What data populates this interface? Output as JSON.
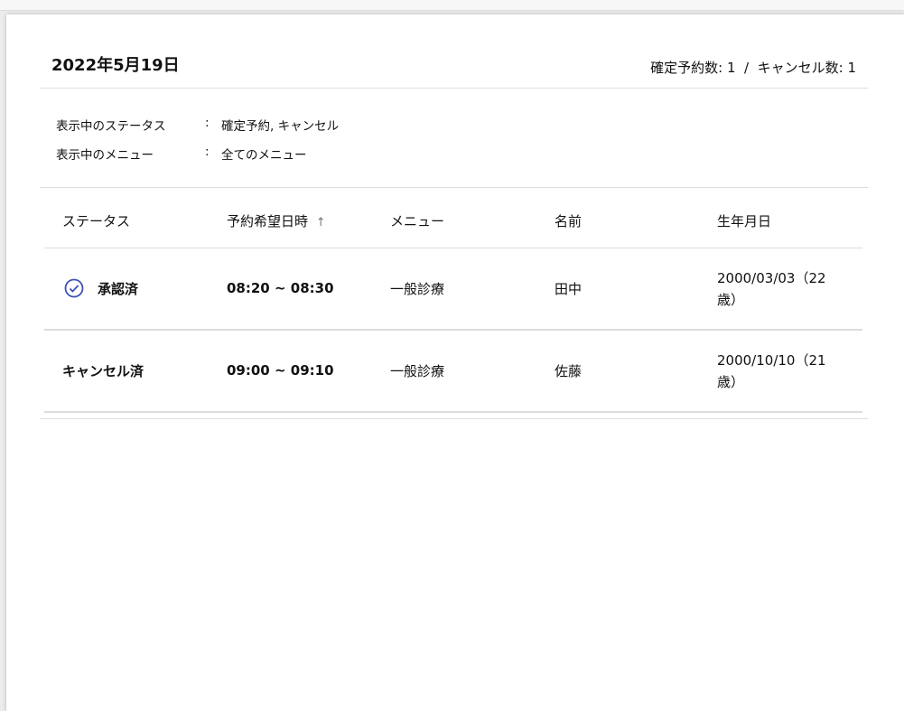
{
  "header": {
    "date": "2022年5月19日",
    "counts": "確定予約数: 1  /  キャンセル数: 1"
  },
  "filters": [
    {
      "label": "表示中のステータス",
      "sep": ":",
      "value": "確定予約, キャンセル"
    },
    {
      "label": "表示中のメニュー",
      "sep": ":",
      "value": "全てのメニュー"
    }
  ],
  "table": {
    "columns": [
      "ステータス",
      "予約希望日時",
      "メニュー",
      "名前",
      "生年月日"
    ],
    "sort_icon": "↑",
    "rows": [
      {
        "status": "承認済",
        "time": "08:20 ~ 08:30",
        "menu": "一般診療",
        "name": "田中",
        "birth": "2000/03/03（22",
        "age": "歳）"
      },
      {
        "status": "キャンセル済",
        "time": "09:00 ~ 09:10",
        "menu": "一般診療",
        "name": "佐藤",
        "birth": "2000/10/10（21",
        "age": "歳）"
      }
    ]
  },
  "colors": {
    "accent": "#3f51b5"
  }
}
